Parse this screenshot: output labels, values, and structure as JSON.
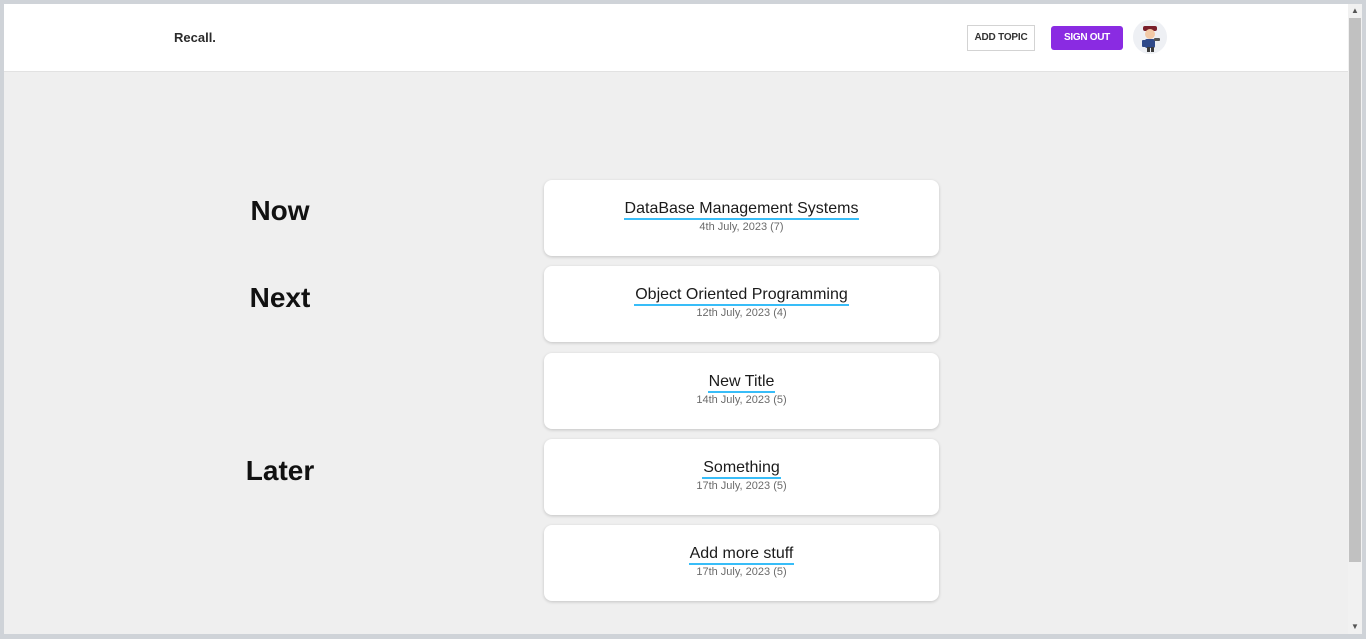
{
  "navbar": {
    "brand": "Recall.",
    "add_topic_label": "ADD TOPIC",
    "sign_out_label": "SIGN OUT",
    "accent_color": "#8a2be2"
  },
  "sections": {
    "now": "Now",
    "next": "Next",
    "later": "Later"
  },
  "topics": [
    {
      "title": "DataBase Management Systems",
      "date": "4th July, 2023 (7)"
    },
    {
      "title": "Object Oriented Programming",
      "date": "12th July, 2023 (4)"
    },
    {
      "title": "New Title",
      "date": "14th July, 2023 (5)"
    },
    {
      "title": "Something",
      "date": "17th July, 2023 (5)"
    },
    {
      "title": "Add more stuff",
      "date": "17th July, 2023 (5)"
    }
  ]
}
